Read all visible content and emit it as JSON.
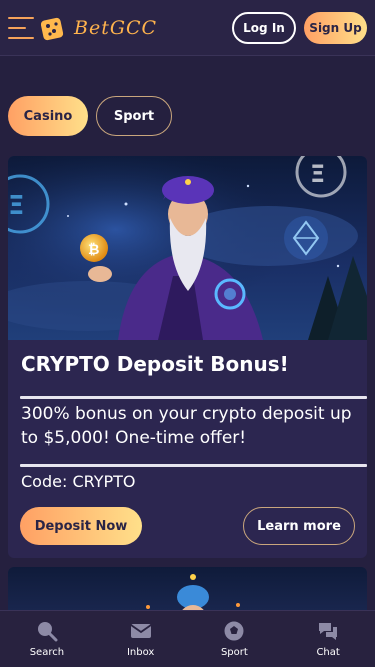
{
  "header": {
    "brand": "BetGCC",
    "login_label": "Log In",
    "signup_label": "Sign Up",
    "brand_color": "#ffb34d"
  },
  "tabs": [
    {
      "label": "Casino",
      "active": true
    },
    {
      "label": "Sport",
      "active": false
    }
  ],
  "promo": {
    "title": "CRYPTO Deposit Bonus!",
    "description": "300% bonus on your crypto deposit up to $5,000! One-time offer!",
    "code": "Code: CRYPTO",
    "primary_button": "Deposit Now",
    "secondary_button": "Learn more"
  },
  "bottom_nav": [
    {
      "label": "Search",
      "icon": "search-icon"
    },
    {
      "label": "Inbox",
      "icon": "mail-icon"
    },
    {
      "label": "Sport",
      "icon": "soccer-ball-icon"
    },
    {
      "label": "Chat",
      "icon": "chat-icon"
    }
  ],
  "colors": {
    "background": "#25203f",
    "accent_gradient_start": "#ffa064",
    "accent_gradient_end": "#ffe08a"
  }
}
